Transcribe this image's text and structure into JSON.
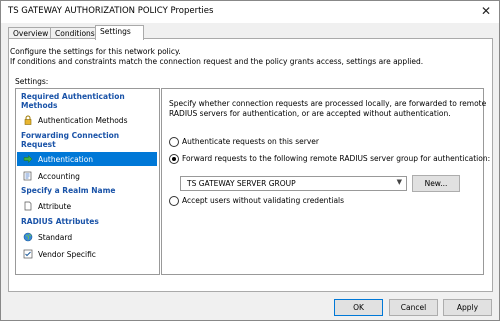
{
  "window": {
    "title": "TS GATEWAY AUTHORIZATION POLICY Properties",
    "close_glyph": "✕"
  },
  "tabs": [
    {
      "label": "Overview"
    },
    {
      "label": "Conditions"
    },
    {
      "label": "Settings"
    }
  ],
  "description": {
    "line1": "Configure the settings for this network policy.",
    "line2": "If conditions and constraints match the connection request and the policy grants access, settings are applied."
  },
  "settings_label": "Settings:",
  "sections": {
    "required_auth": {
      "line1": "Required Authentication",
      "line2": "Methods"
    },
    "forwarding": {
      "line1": "Forwarding Connection",
      "line2": "Request"
    },
    "realm": "Specify a Realm Name",
    "radius": "RADIUS Attributes"
  },
  "items": {
    "auth_methods": "Authentication Methods",
    "authentication": "Authentication",
    "accounting": "Accounting",
    "attribute": "Attribute",
    "standard": "Standard",
    "vendor_specific": "Vendor Specific"
  },
  "pane": {
    "desc_line1": "Specify whether connection requests are processed locally, are forwarded to remote",
    "desc_line2": "RADIUS servers for authentication, or are accepted without authentication.",
    "radio_local": "Authenticate requests on this server",
    "radio_forward": "Forward requests to the following remote RADIUS server group for authentication:",
    "group_value": "TS GATEWAY SERVER GROUP",
    "new_button": "New...",
    "radio_accept": "Accept users without validating credentials"
  },
  "buttons": {
    "ok": "OK",
    "cancel": "Cancel",
    "apply": "Apply"
  },
  "colors": {
    "section_header": "#1a53a8",
    "selection": "#0078d7"
  }
}
